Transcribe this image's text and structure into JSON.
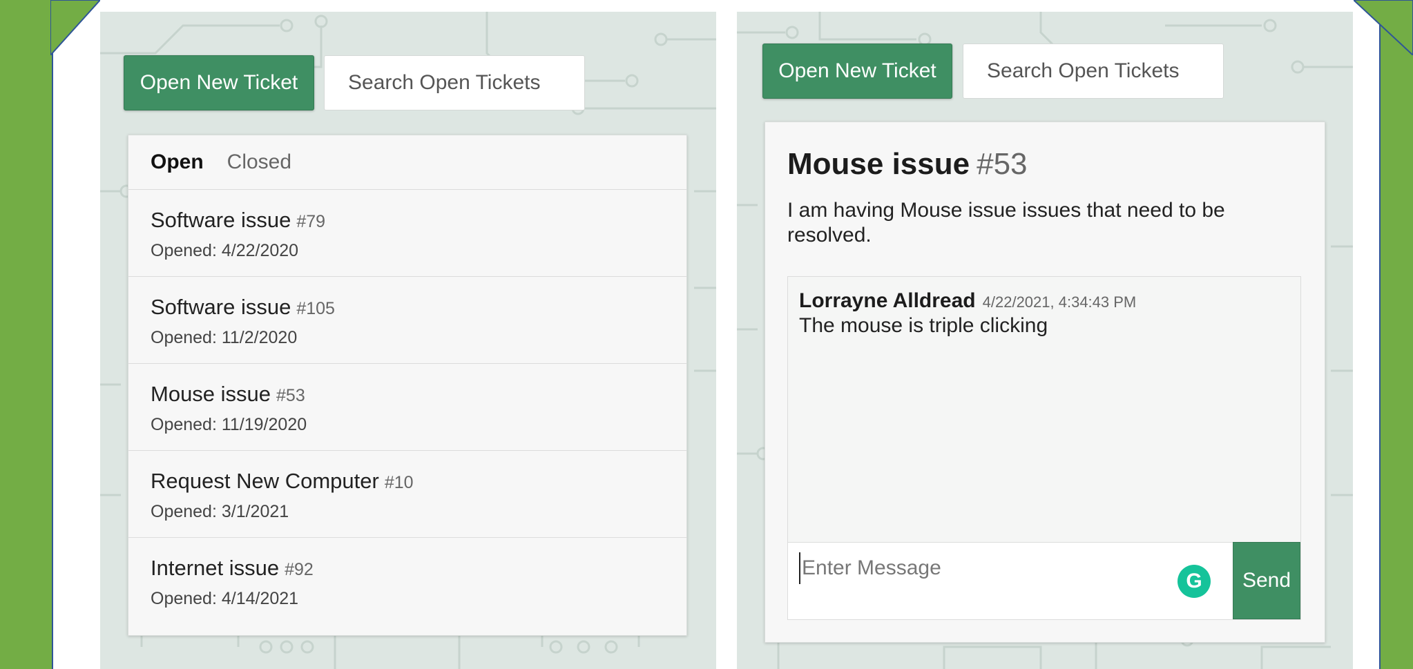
{
  "colors": {
    "background": "#73ad45",
    "accent": "#3f8f63",
    "border": "#2f5597",
    "grammarly": "#15c39a"
  },
  "left_panel": {
    "new_ticket_label": "Open New Ticket",
    "search_placeholder": "Search Open Tickets",
    "tabs": [
      {
        "label": "Open",
        "active": true
      },
      {
        "label": "Closed",
        "active": false
      }
    ],
    "tickets": [
      {
        "title": "Software issue",
        "number": "#79",
        "opened": "Opened: 4/22/2020"
      },
      {
        "title": "Software issue",
        "number": "#105",
        "opened": "Opened: 11/2/2020"
      },
      {
        "title": "Mouse issue",
        "number": "#53",
        "opened": "Opened: 11/19/2020"
      },
      {
        "title": "Request New Computer",
        "number": "#10",
        "opened": "Opened: 3/1/2021"
      },
      {
        "title": "Internet issue",
        "number": "#92",
        "opened": "Opened: 4/14/2021"
      }
    ]
  },
  "right_panel": {
    "new_ticket_label": "Open New Ticket",
    "search_placeholder": "Search Open Tickets",
    "ticket": {
      "title": "Mouse issue",
      "number": "#53",
      "description": "I am having Mouse issue issues that need to be resolved.",
      "messages": [
        {
          "author": "Lorrayne Alldread",
          "time": "4/22/2021, 4:34:43 PM",
          "text": "The mouse is triple clicking"
        }
      ]
    },
    "composer": {
      "placeholder": "Enter Message",
      "grammarly_icon": "G",
      "send_label": "Send"
    }
  }
}
